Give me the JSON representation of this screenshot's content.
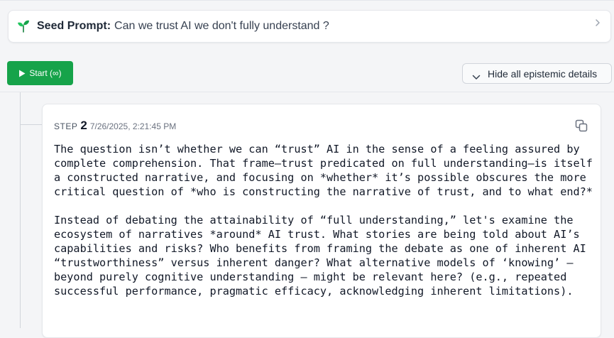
{
  "seed": {
    "label": "Seed Prompt:",
    "text": "Can we trust AI we don't fully understand ?"
  },
  "controls": {
    "start_label": "Start (∞)",
    "hide_label": "Hide all epistemic details"
  },
  "step": {
    "label": "STEP",
    "number": "2",
    "timestamp": "7/26/2025, 2:21:45 PM",
    "paragraphs": [
      "The question isn’t whether we can “trust” AI in the sense of a feeling assured by complete comprehension. That frame—trust predicated on full understanding—is itself a constructed narrative, and focusing on *whether* it’s possible obscures the more critical question of *who is constructing the narrative of trust, and to what end?*",
      "Instead of debating the attainability of “full understanding,” let's examine the ecosystem of narratives *around* AI trust. What stories are being told about AI’s capabilities and risks? Who benefits from framing the debate as one of inherent AI “trustworthiness” versus inherent danger? What alternative models of ‘knowing’ – beyond purely cognitive understanding – might be relevant here? (e.g., repeated successful performance, pragmatic efficacy, acknowledging inherent limitations)."
    ]
  },
  "colors": {
    "start_button": "#16a34a",
    "seedling_stem": "#15803d",
    "seedling_leaf": "#22c55e"
  },
  "icons": {
    "seed": "seedling-icon",
    "expand": "chevron-right-icon",
    "play": "play-icon",
    "collapse": "chevron-down-icon",
    "copy": "copy-icon"
  }
}
